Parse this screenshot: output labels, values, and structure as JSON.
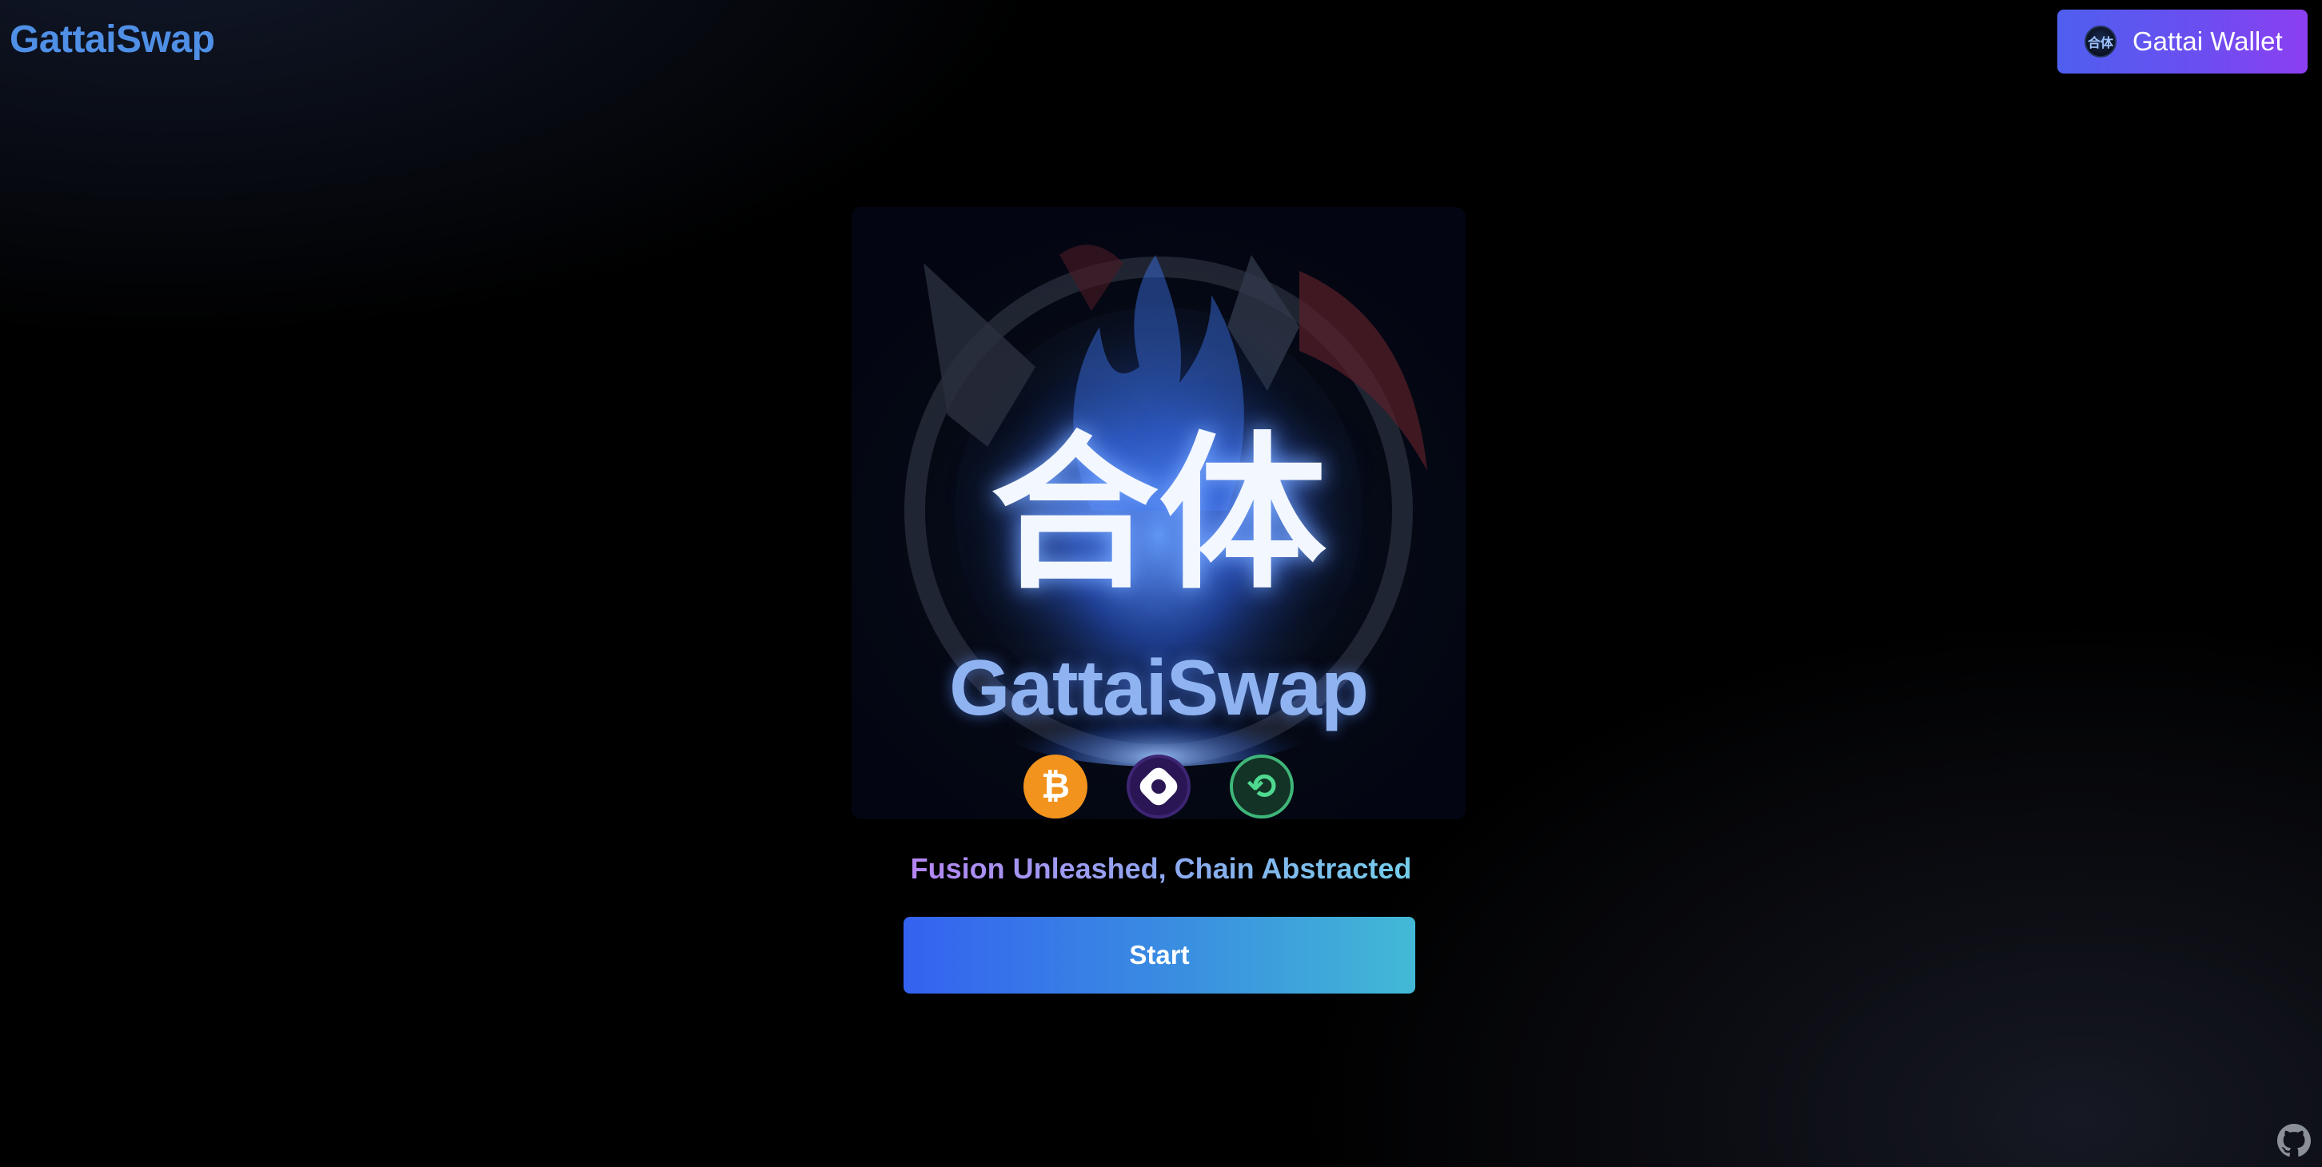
{
  "header": {
    "brand": "GattaiSwap",
    "wallet_button_label": "Gattai Wallet",
    "wallet_avatar_text": "合体"
  },
  "hero": {
    "kanji": "合体",
    "title": "GattaiSwap",
    "coins": [
      {
        "name": "bitcoin-icon",
        "glyph": "₿"
      },
      {
        "name": "middle-token-icon",
        "glyph": ""
      },
      {
        "name": "link-icon",
        "glyph": "⟲"
      }
    ]
  },
  "tagline": "Fusion Unleashed, Chain Abstracted",
  "start_button_label": "Start",
  "colors": {
    "brand": "#4f8fe6",
    "wallet_gradient_start": "#4f5ff0",
    "wallet_gradient_end": "#8b3ff0",
    "start_gradient_start": "#3462f0",
    "start_gradient_end": "#42b9d6"
  }
}
